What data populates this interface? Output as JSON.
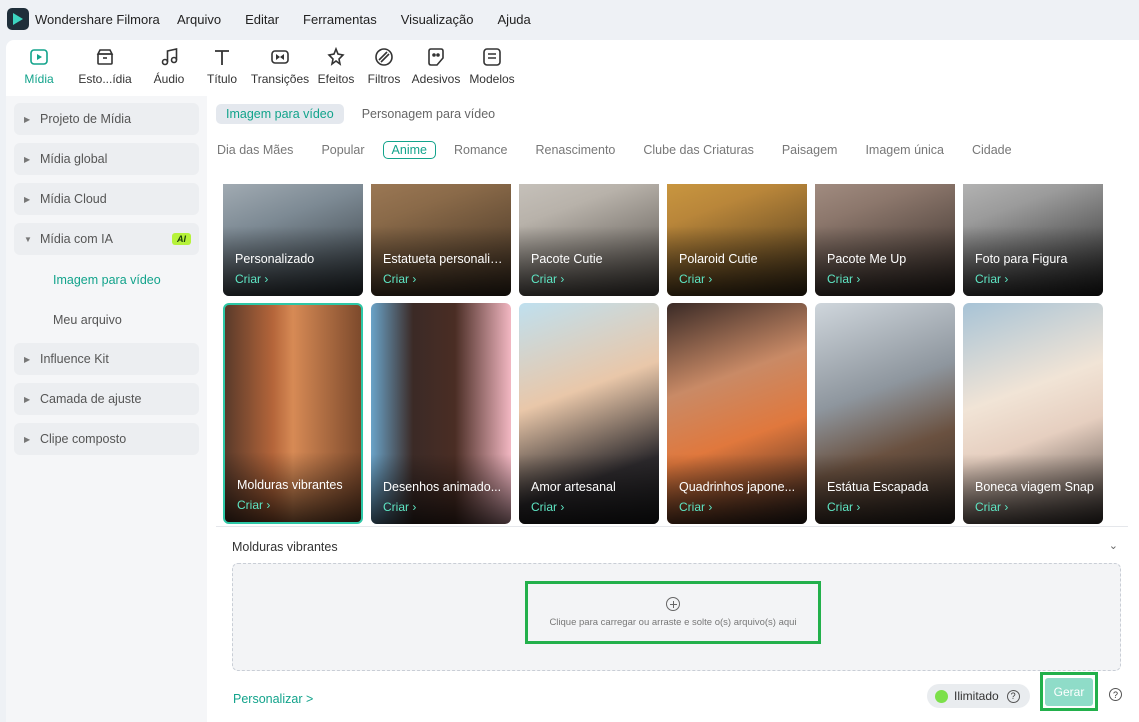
{
  "app": {
    "title": "Wondershare Filmora"
  },
  "menu": [
    "Arquivo",
    "Editar",
    "Ferramentas",
    "Visualização",
    "Ajuda"
  ],
  "toolbar": [
    {
      "label": "Mídia",
      "icon": "media-icon",
      "active": true
    },
    {
      "label": "Esto...ídia",
      "icon": "stock-media-icon"
    },
    {
      "label": "Áudio",
      "icon": "music-note-icon"
    },
    {
      "label": "Título",
      "icon": "text-t-icon"
    },
    {
      "label": "Transições",
      "icon": "transitions-icon"
    },
    {
      "label": "Efeitos",
      "icon": "effects-icon"
    },
    {
      "label": "Filtros",
      "icon": "filters-icon"
    },
    {
      "label": "Adesivos",
      "icon": "stickers-icon"
    },
    {
      "label": "Modelos",
      "icon": "templates-icon"
    }
  ],
  "sidebar": {
    "items": [
      {
        "label": "Projeto de Mídia"
      },
      {
        "label": "Mídia global"
      },
      {
        "label": "Mídia Cloud"
      },
      {
        "label": "Mídia com IA",
        "badge": "AI",
        "expanded": true
      },
      {
        "label": "Influence Kit"
      },
      {
        "label": "Camada de ajuste"
      },
      {
        "label": "Clipe composto"
      }
    ],
    "subitems": [
      {
        "label": "Imagem para vídeo",
        "active": true
      },
      {
        "label": "Meu arquivo"
      }
    ]
  },
  "tabs": [
    "Imagem para vídeo",
    "Personagem para vídeo"
  ],
  "categories": [
    "Dia das Mães",
    "Popular",
    "Anime",
    "Romance",
    "Renascimento",
    "Clube das Criaturas",
    "Paisagem",
    "Imagem única",
    "Cidade"
  ],
  "active_category": "Anime",
  "cards_row1": [
    {
      "title": "Personalizado",
      "cta": "Criar ›"
    },
    {
      "title": "Estatueta personaliz...",
      "cta": "Criar ›"
    },
    {
      "title": "Pacote Cutie",
      "cta": "Criar ›"
    },
    {
      "title": "Polaroid Cutie",
      "cta": "Criar ›"
    },
    {
      "title": "Pacote Me Up",
      "cta": "Criar ›"
    },
    {
      "title": "Foto para Figura",
      "cta": "Criar ›"
    }
  ],
  "cards_row2": [
    {
      "title": "Molduras vibrantes",
      "cta": "Criar ›",
      "selected": true
    },
    {
      "title": "Desenhos animado...",
      "cta": "Criar ›"
    },
    {
      "title": "Amor artesanal",
      "cta": "Criar ›"
    },
    {
      "title": "Quadrinhos japone...",
      "cta": "Criar ›"
    },
    {
      "title": "Estátua Escapada",
      "cta": "Criar ›"
    },
    {
      "title": "Boneca viagem Snap",
      "cta": "Criar ›"
    }
  ],
  "panel": {
    "title": "Molduras vibrantes",
    "upload_text": "Clique para carregar ou arraste e solte o(s) arquivo(s) aqui",
    "personalize": "Personalizar >",
    "credit": "Ilimitado",
    "generate": "Gerar"
  },
  "colors": {
    "accent": "#12a38b",
    "highlight": "#22b04b",
    "ai_badge": "#b6f23a"
  }
}
